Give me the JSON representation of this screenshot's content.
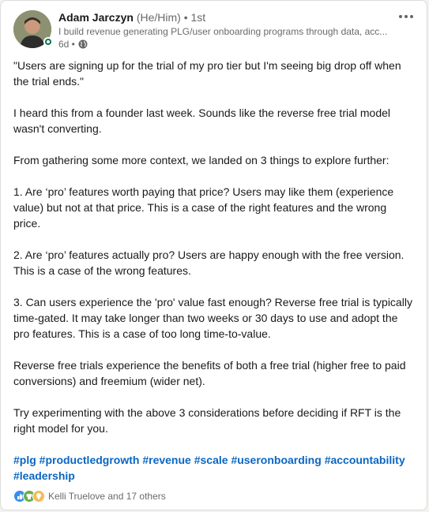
{
  "post": {
    "author": {
      "name": "Adam Jarczyn",
      "pronouns": "(He/Him)",
      "connection": "• 1st",
      "headline": "I build revenue generating PLG/user onboarding programs through data, acc...",
      "time": "6d •"
    },
    "icons": [
      "avatar",
      "globe-icon",
      "more-options-icon",
      "like-icon",
      "celebrate-icon",
      "insight-icon"
    ],
    "paragraphs": [
      "\"Users are signing up for the trial of my pro tier but I'm seeing big drop off when the trial ends.\"",
      "I heard this from a founder last week. Sounds like the reverse free trial model wasn't converting.",
      "From gathering some more context, we landed on 3 things to explore further:",
      "1. Are ‘pro’ features worth paying that price? Users may like them (experience value) but not at that price. This is a case of the right features and the wrong price.",
      "2. Are ‘pro’ features actually pro? Users are happy enough with the free version. This is a case of the wrong features.",
      "3. Can users experience the 'pro' value fast enough? Reverse free trial is typically time-gated. It may take longer than two weeks or 30 days to use and adopt the pro features. This is a case of too long time-to-value.",
      "Reverse free trials experience the benefits of both a free trial (higher free to paid conversions) and freemium (wider net).",
      "Try experimenting with the above 3 considerations before deciding if RFT is the right model for you."
    ],
    "hashtags": [
      "#plg",
      "#productledgrowth",
      "#revenue",
      "#scale",
      "#useronboarding",
      "#accountability",
      "#leadership"
    ],
    "reactions_text": "Kelli Truelove and 17 others"
  },
  "colors": {
    "link": "#0a66c2",
    "open_to_work_ring": "#01754f",
    "like": "#378fe9",
    "celebrate": "#6dae4f",
    "insight": "#f5bb5c"
  }
}
